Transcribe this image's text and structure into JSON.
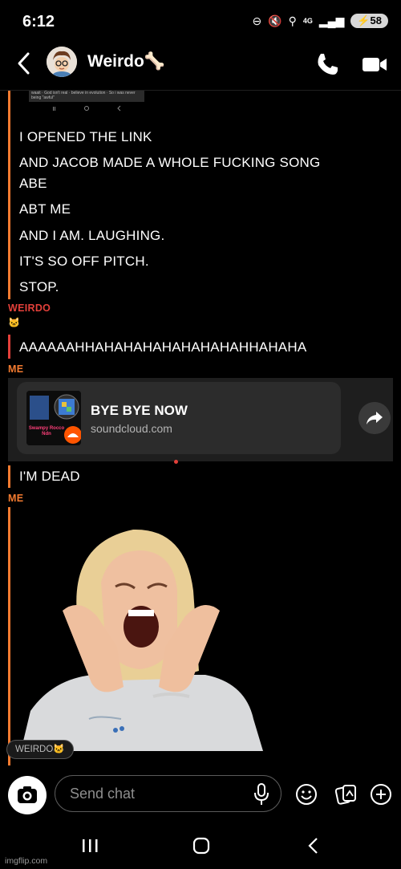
{
  "status_bar": {
    "time": "6:12",
    "battery": "58",
    "network": "4G"
  },
  "header": {
    "contact_name": "Weirdo🦴"
  },
  "messages": [
    "I OPENED THE LINK",
    "AND JACOB MADE A WHOLE FUCKING SONG",
    "ABE",
    "ABT ME",
    "AND I AM. LAUGHING.",
    "IT'S SO OFF PITCH.",
    "STOP."
  ],
  "snippet_text": "waait · God isn't real · believe in evolution · So i was never being \"awful\"",
  "weirdo": {
    "sender": "WEIRDO",
    "reaction": "🐱",
    "message": "AAAAAAHHAHAHAHAHAHAHAHAHHAHAHA"
  },
  "me_1": {
    "sender": "ME",
    "link_title": "BYE BYE NOW",
    "link_domain": "soundcloud.com",
    "thumb_text": "Swampy Rocco Ndn",
    "message": "I'M DEAD"
  },
  "me_2": {
    "sender": "ME",
    "reaction_pill": "WEIRDO🐱"
  },
  "input": {
    "placeholder": "Send chat"
  },
  "watermark": "imgflip.com",
  "colors": {
    "me": "#f47b30",
    "weirdo": "#e3403a",
    "background": "#000000"
  }
}
